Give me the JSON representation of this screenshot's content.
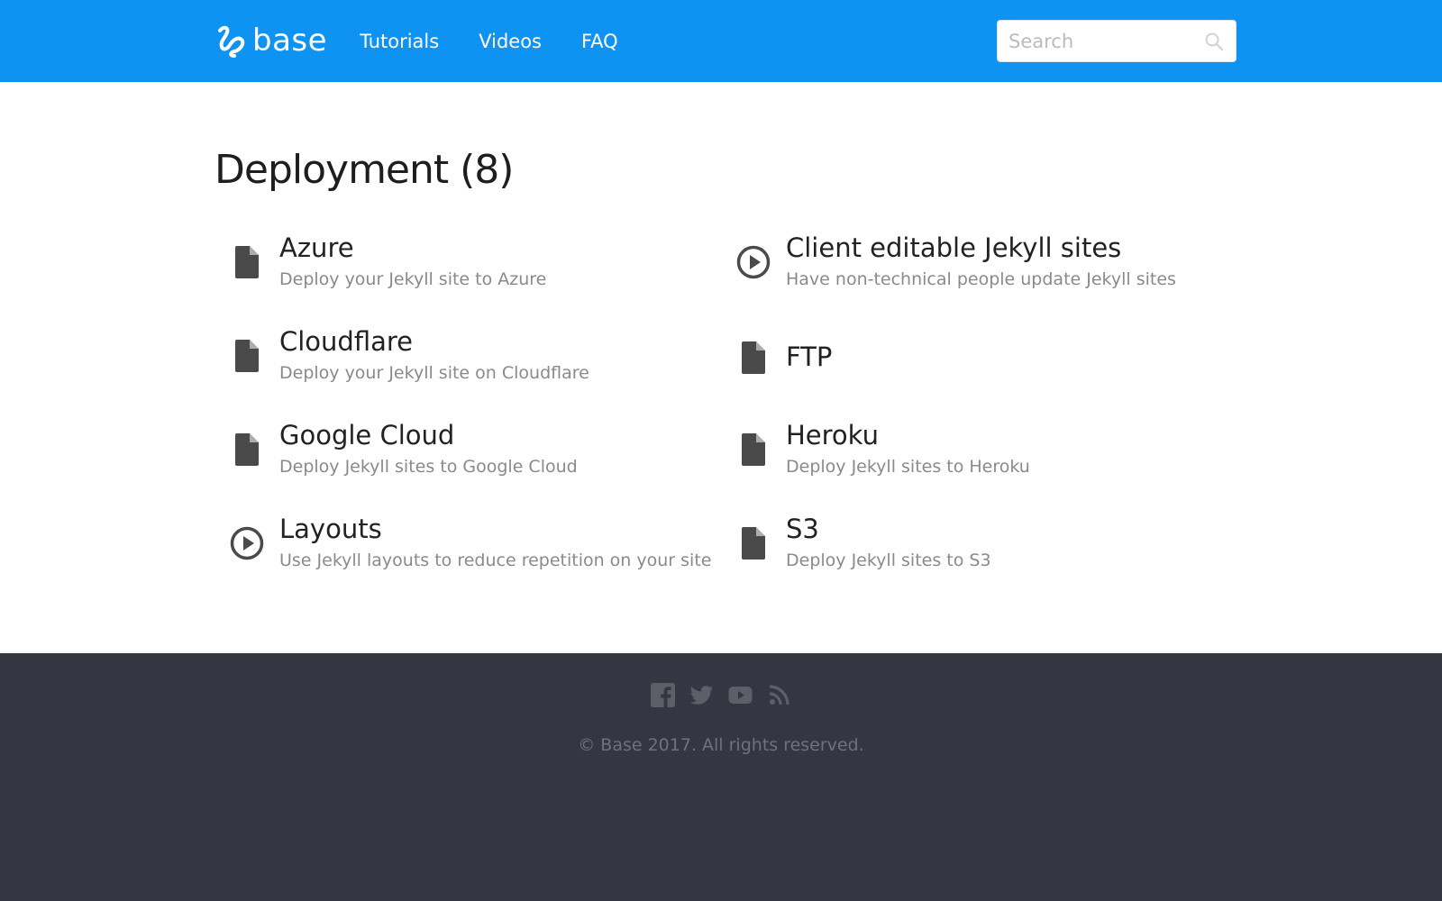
{
  "header": {
    "logo_text": "base",
    "nav": [
      {
        "label": "Tutorials"
      },
      {
        "label": "Videos"
      },
      {
        "label": "FAQ"
      }
    ],
    "search": {
      "placeholder": "Search",
      "value": ""
    }
  },
  "colors": {
    "header_bg": "#0e93f2",
    "footer_bg": "#343641",
    "icon": "#4a4a4a"
  },
  "main": {
    "title": "Deployment (8)",
    "items": [
      {
        "title": "Azure",
        "description": "Deploy your Jekyll site to Azure",
        "icon": "document-icon"
      },
      {
        "title": "Client editable Jekyll sites",
        "description": "Have non-technical people update Jekyll sites",
        "icon": "play-circle-icon"
      },
      {
        "title": "Cloudflare",
        "description": "Deploy your Jekyll site on Cloudflare",
        "icon": "document-icon"
      },
      {
        "title": "FTP",
        "description": "",
        "icon": "document-icon"
      },
      {
        "title": "Google Cloud",
        "description": "Deploy Jekyll sites to Google Cloud",
        "icon": "document-icon"
      },
      {
        "title": "Heroku",
        "description": "Deploy Jekyll sites to Heroku",
        "icon": "document-icon"
      },
      {
        "title": "Layouts",
        "description": "Use Jekyll layouts to reduce repetition on your site",
        "icon": "play-circle-icon"
      },
      {
        "title": "S3",
        "description": "Deploy Jekyll sites to S3",
        "icon": "document-icon"
      }
    ]
  },
  "footer": {
    "social": [
      "facebook-icon",
      "twitter-icon",
      "youtube-icon",
      "rss-icon"
    ],
    "copyright": "© Base 2017. All rights reserved."
  }
}
